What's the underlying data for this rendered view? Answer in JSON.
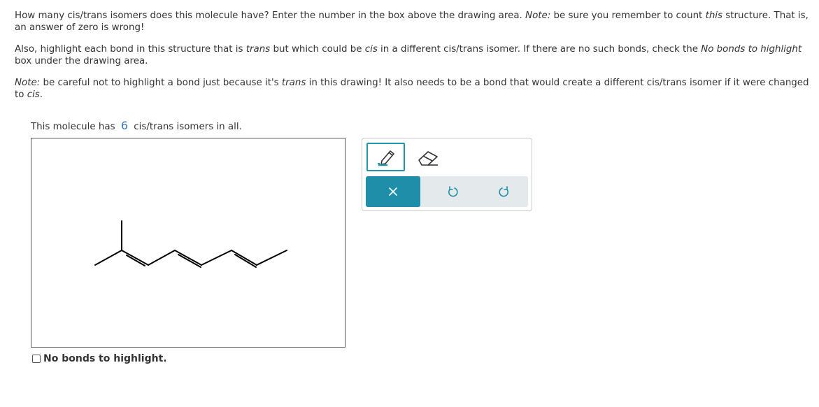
{
  "question": {
    "p1": [
      {
        "text": "How many cis/trans isomers does this molecule have? Enter the number in the box above the drawing area. ",
        "italic": false
      },
      {
        "text": "Note:",
        "italic": true
      },
      {
        "text": " be sure you remember to count ",
        "italic": false
      },
      {
        "text": "this",
        "italic": true
      },
      {
        "text": " structure. That is, an answer of zero is wrong!",
        "italic": false
      }
    ],
    "p2": [
      {
        "text": "Also, highlight each bond in this structure that is ",
        "italic": false
      },
      {
        "text": "trans",
        "italic": true
      },
      {
        "text": " but which could be ",
        "italic": false
      },
      {
        "text": "cis",
        "italic": true
      },
      {
        "text": " in a different cis/trans isomer. If there are no such bonds, check the ",
        "italic": false
      },
      {
        "text": "No bonds to highlight",
        "italic": true
      },
      {
        "text": " box under the drawing area.",
        "italic": false
      }
    ],
    "p3": [
      {
        "text": "Note:",
        "italic": true
      },
      {
        "text": " be careful not to highlight a bond just because it's ",
        "italic": false
      },
      {
        "text": "trans",
        "italic": true
      },
      {
        "text": " in this drawing! It also needs to be a bond that would create a different cis/trans isomer if it were changed to ",
        "italic": false
      },
      {
        "text": "cis",
        "italic": true
      },
      {
        "text": ".",
        "italic": false
      }
    ]
  },
  "answer": {
    "prefix": "This molecule has",
    "value": "6",
    "suffix": "cis/trans isomers in all."
  },
  "palette": {
    "accent_color": "#1f8fa9",
    "tools": [
      "pencil-icon",
      "eraser-icon"
    ],
    "actions": [
      "clear-icon",
      "undo-icon",
      "redo-icon"
    ]
  },
  "checkbox": {
    "label": "No bonds to highlight.",
    "checked": false
  }
}
